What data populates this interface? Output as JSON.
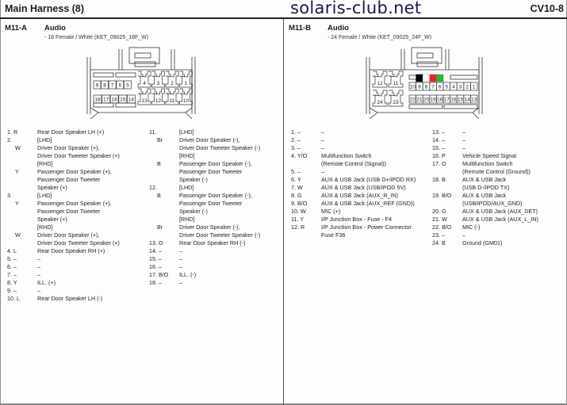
{
  "header": {
    "title": "Main Harness (8)",
    "watermark": "solaris-club.net",
    "page_code": "CV10-8"
  },
  "connectors": [
    {
      "id": "M11-A",
      "name": "Audio",
      "subtitle": "- 18 Female / White (KET_09025_18F_W)",
      "pins_top_left": [
        "9",
        "8",
        "7",
        "6",
        "5"
      ],
      "pins_top_right": [
        "4",
        "3",
        "2",
        "1"
      ],
      "pins_bottom_left": [
        "18",
        "17",
        "16",
        "15",
        "14"
      ],
      "pins_bottom_right": [
        "13",
        "12",
        "11",
        "10"
      ],
      "columns": [
        [
          {
            "no": "1. R",
            "desc": "Rear Door Speaker LH (+)"
          },
          {
            "no": "2.",
            "desc": "[LHD]"
          },
          {
            "no": "    W",
            "desc": "Driver Door Speaker (+),"
          },
          {
            "no": "",
            "desc": "Driver Door Tweeter Speaker (+)"
          },
          {
            "no": "",
            "desc": "[RHD]"
          },
          {
            "no": "    Y",
            "desc": "Passenger Door Speaker (+),"
          },
          {
            "no": "",
            "desc": "Passenger Door Tweeter"
          },
          {
            "no": "",
            "desc": "Speaker (+)"
          },
          {
            "no": "3.",
            "desc": "[LHD]"
          },
          {
            "no": "    Y",
            "desc": "Passenger Door Speaker (+),"
          },
          {
            "no": "",
            "desc": "Passenger Door Tweeter"
          },
          {
            "no": "",
            "desc": "Speaker (+)"
          },
          {
            "no": "",
            "desc": "[RHD]"
          },
          {
            "no": "    W",
            "desc": "Driver Door Speaker (+),"
          },
          {
            "no": "",
            "desc": "Driver Door Tweeter Speaker (+)"
          },
          {
            "no": "4. L",
            "desc": "Rear Door Speaker RH (+)"
          },
          {
            "no": "5. –",
            "desc": "–"
          },
          {
            "no": "6. –",
            "desc": "–"
          },
          {
            "no": "7. –",
            "desc": "–"
          },
          {
            "no": "8. Y",
            "desc": "ILL. (+)"
          },
          {
            "no": "9. –",
            "desc": "–"
          },
          {
            "no": "10. L",
            "desc": "Rear Door Speaker LH (-)"
          }
        ],
        [
          {
            "no": "11.",
            "desc": "[LHD]"
          },
          {
            "no": "    Br",
            "desc": "Driver Door Speaker (-),"
          },
          {
            "no": "",
            "desc": "Driver Door Tweeter Speaker (-)"
          },
          {
            "no": "",
            "desc": "[RHD]"
          },
          {
            "no": "    B",
            "desc": "Passenger Door Speaker (-),"
          },
          {
            "no": "",
            "desc": "Passenger Door Tweeter"
          },
          {
            "no": "",
            "desc": "Speaker (-)"
          },
          {
            "no": "12.",
            "desc": "[LHD]"
          },
          {
            "no": "    B",
            "desc": "Passenger Door Speaker (-),"
          },
          {
            "no": "",
            "desc": "Passenger Door Tweeter"
          },
          {
            "no": "",
            "desc": "Speaker (-)"
          },
          {
            "no": "",
            "desc": "[RHD]"
          },
          {
            "no": "    Br",
            "desc": "Driver Door Speaker (-),"
          },
          {
            "no": "",
            "desc": "Driver Door Tweeter Speaker (-)"
          },
          {
            "no": "13. O",
            "desc": "Rear Door Speaker RH (-)"
          },
          {
            "no": "14. –",
            "desc": "–"
          },
          {
            "no": "15. –",
            "desc": "–"
          },
          {
            "no": "16. –",
            "desc": "–"
          },
          {
            "no": "17. B/O",
            "desc": "ILL. (-)"
          },
          {
            "no": "18. –",
            "desc": "–"
          }
        ]
      ]
    },
    {
      "id": "M11-B",
      "name": "Audio",
      "subtitle": "- 24 Female / White (KET_09025_24F_W)",
      "pins_big_top": [
        "12",
        "11"
      ],
      "pins_big_bottom": [
        "24",
        "23"
      ],
      "pins_small_top": [
        "10",
        "9",
        "8",
        "7",
        "6",
        "5",
        "4",
        "3",
        "2",
        "1"
      ],
      "pins_small_bottom": [
        "22",
        "21",
        "20",
        "19",
        "18",
        "17",
        "16",
        "15",
        "14",
        "13"
      ],
      "wire_markers": [
        {
          "pin": "9",
          "color": "#000000"
        },
        {
          "pin": "8",
          "color": "#ffffff"
        },
        {
          "pin": "7",
          "color": "#e8262b"
        },
        {
          "pin": "6",
          "color": "#2fb33a"
        }
      ],
      "columns": [
        [
          {
            "no": "1. –",
            "desc": "–"
          },
          {
            "no": "2. –",
            "desc": "–"
          },
          {
            "no": "3. –",
            "desc": "–"
          },
          {
            "no": "4. Y/O",
            "desc": "Multifunction Switch"
          },
          {
            "no": "",
            "desc": "(Remote Control (Signal))"
          },
          {
            "no": "5. –",
            "desc": "–"
          },
          {
            "no": "6. Y",
            "desc": "AUX & USB Jack (USB D+/iPOD RX)"
          },
          {
            "no": "7. W",
            "desc": "AUX & USB Jack (USB/iPOD 5V)"
          },
          {
            "no": "8. G",
            "desc": "AUX & USB Jack (AUX_R_IN)"
          },
          {
            "no": "9. B/O",
            "desc": "AUX & USB Jack (AUX_REF (GND))"
          },
          {
            "no": "10. W",
            "desc": "MIC (+)"
          },
          {
            "no": "11. Y",
            "desc": "I/P Junction Box - Fuse - F4"
          },
          {
            "no": "12. R",
            "desc": "I/P Junction Box - Power Connector"
          },
          {
            "no": "",
            "desc": "Fuse F36"
          }
        ],
        [
          {
            "no": "13. –",
            "desc": "–"
          },
          {
            "no": "14. –",
            "desc": "–"
          },
          {
            "no": "15. –",
            "desc": "–"
          },
          {
            "no": "16. P",
            "desc": "Vehicle Speed Signal"
          },
          {
            "no": "17. O",
            "desc": "Multifunction Switch"
          },
          {
            "no": "",
            "desc": "(Remote Control (Ground))"
          },
          {
            "no": "18. B",
            "desc": "AUX & USB Jack"
          },
          {
            "no": "",
            "desc": "(USB D-/iPOD TX)"
          },
          {
            "no": "19. B/O",
            "desc": "AUX & USB Jack"
          },
          {
            "no": "",
            "desc": "(USB/iPOD/AUX_GND)"
          },
          {
            "no": "20. G",
            "desc": "AUX & USB Jack (AUX_DET)"
          },
          {
            "no": "21. W",
            "desc": "AUX & USB Jack (AUX_L_IN)"
          },
          {
            "no": "22. B/O",
            "desc": "MIC (-)"
          },
          {
            "no": "23. –",
            "desc": "–"
          },
          {
            "no": "24. B",
            "desc": "Ground (GM01)"
          }
        ]
      ]
    }
  ]
}
